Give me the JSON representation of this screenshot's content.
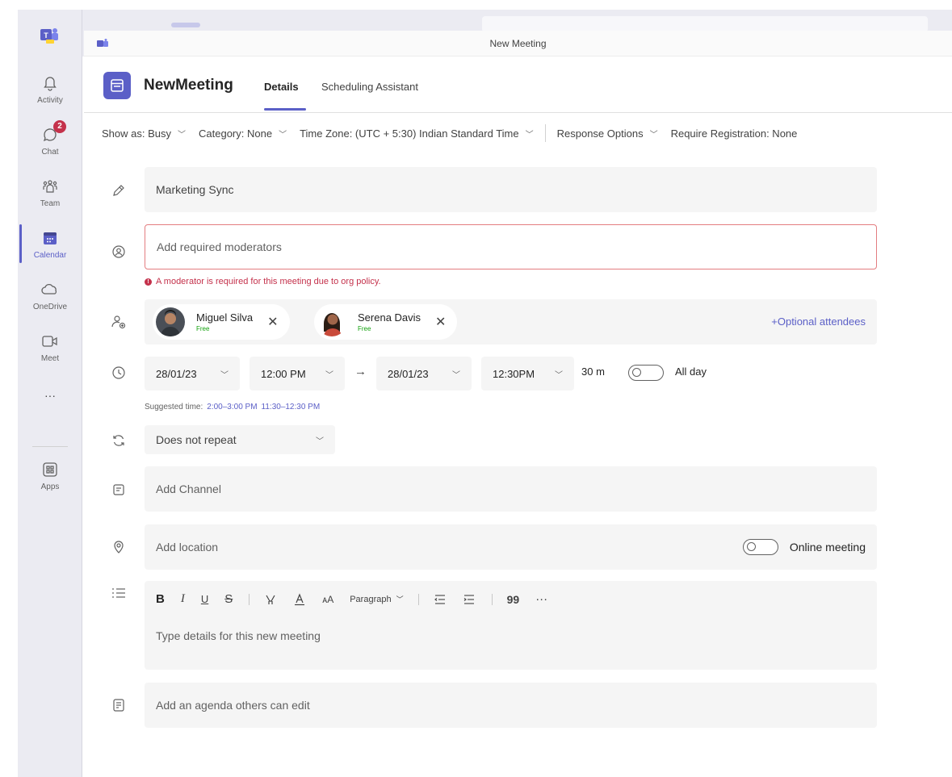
{
  "rail": {
    "items": [
      {
        "label": "Activity"
      },
      {
        "label": "Chat",
        "badge": "2"
      },
      {
        "label": "Team"
      },
      {
        "label": "Calendar"
      },
      {
        "label": "OneDrive"
      },
      {
        "label": "Meet"
      },
      {
        "label": "···"
      },
      {
        "label": "Apps"
      }
    ],
    "active": "Calendar"
  },
  "window": {
    "title": "New Meeting"
  },
  "header": {
    "title": "NewMeeting",
    "tabs": [
      {
        "label": "Details",
        "active": true
      },
      {
        "label": "Scheduling Assistant",
        "active": false
      }
    ]
  },
  "options": {
    "show_as": "Show as: Busy",
    "category": "Category: None",
    "time_zone": "Time Zone: (UTC + 5:30) Indian Standard Time",
    "response": "Response Options",
    "registration": "Require Registration: None"
  },
  "form": {
    "title_value": "Marketing Sync",
    "moderators_placeholder": "Add required moderators",
    "moderator_error": "A moderator is required for this meeting due to org policy.",
    "attendees": [
      {
        "name": "Miguel Silva",
        "status": "Free"
      },
      {
        "name": "Serena Davis",
        "status": "Free"
      }
    ],
    "optional_attendees": "+Optional attendees",
    "start_date": "28/01/23",
    "start_time": "12:00 PM",
    "end_date": "28/01/23",
    "end_time": "12:30PM",
    "duration": "30 m",
    "all_day": "All day",
    "suggested_label": "Suggested time:",
    "suggested_times": [
      "2:00–3:00 PM",
      "11:30–12:30 PM"
    ],
    "repeat": "Does not repeat",
    "channel_placeholder": "Add Channel",
    "location_placeholder": "Add location",
    "online_meeting": "Online meeting",
    "editor_paragraph": "Paragraph",
    "details_placeholder": "Type details for this new meeting",
    "agenda_placeholder": "Add an agenda others can edit"
  },
  "colors": {
    "accent": "#5b5fc7",
    "error": "#c4314b",
    "free": "#13a10e"
  }
}
